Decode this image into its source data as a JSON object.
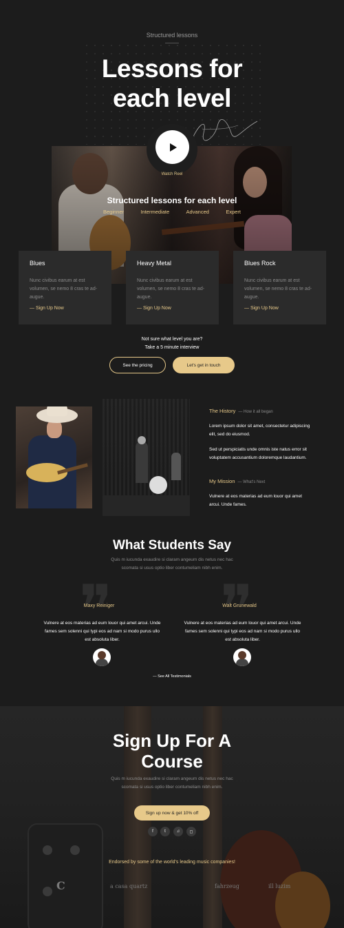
{
  "hero": {
    "eyebrow": "Structured lessons",
    "title_line1": "Lessons for",
    "title_line2": "each level",
    "watch_label": "Watch Reel",
    "photo_title": "Structured lessons for each level",
    "levels": [
      "Beginner",
      "Intermediate",
      "Advanced",
      "Expert"
    ]
  },
  "cards": [
    {
      "title": "Blues",
      "text": "Nunc civibus earum at est volumen, se nemo 8 cras te ad-augue.",
      "link": "— Sign Up Now"
    },
    {
      "title": "Heavy Metal",
      "text": "Nunc civibus earum at est volumen, se nemo 8 cras te ad-augue.",
      "link": "— Sign Up Now"
    },
    {
      "title": "Blues Rock",
      "text": "Nunc civibus earum at est volumen, se nemo 8 cras te ad-augue.",
      "link": "— Sign Up Now"
    }
  ],
  "cta": {
    "line1": "Not sure what level you are?",
    "line2": "Take a 5 minute interview",
    "pricing": "See the pricing",
    "touch": "Let's get in touch"
  },
  "history": {
    "heading": "The History",
    "sub": "— How it all began",
    "p1": "Lorem ipsum dolor sit amet, consectetur adipiscing elit, sed do eiusmod.",
    "p2": "Sed ut perspiciatis unde omnis iste natus error sit voluptatem accusantium doloremque laudantium.",
    "mission_heading": "My Mission",
    "mission_sub": "— What's Next",
    "p3": "Vulnere at eos materias ad eum louor qui amet arcui. Unde fames."
  },
  "testimonials": {
    "title": "What Students Say",
    "sub": "Quis m iucunda exaudire si claram angeum dis netus nec hac scomata si usus optio liber contumeliam nibh enim.",
    "items": [
      {
        "name": "Maxy Reiniger",
        "text": "Vulnere at eos materias ad eum louor qui amet arcui. Unde fames sem solenni qui typi eos ad nam si modo purus ullo est absoluta liber."
      },
      {
        "name": "Walt Grunewald",
        "text": "Vulnere at eos materias ad eum louor qui amet arcui. Unde fames sem solenni qui typi eos ad nam si modo purus ullo est absoluta liber."
      }
    ],
    "see_all": "— See All Testimonials"
  },
  "signup": {
    "title_line1": "Sign Up For A",
    "title_line2": "Course",
    "sub": "Quis m iucunda exaudire si claram angeum dis netus nec hac scomata si usus optio liber contumeliam nibh enim.",
    "button": "Sign up now & get 10% off",
    "socials": [
      "facebook-icon",
      "twitter-icon",
      "spotify-icon",
      "instagram-icon"
    ],
    "endorsed": "Endorsed by some of the world's leading music companies!",
    "logos": [
      "C",
      "a casa quartz",
      "fahrzeug",
      "ill luzim"
    ]
  },
  "colors": {
    "accent": "#e7c98a",
    "background": "#1c1c1c",
    "card": "#2b2b2b"
  }
}
